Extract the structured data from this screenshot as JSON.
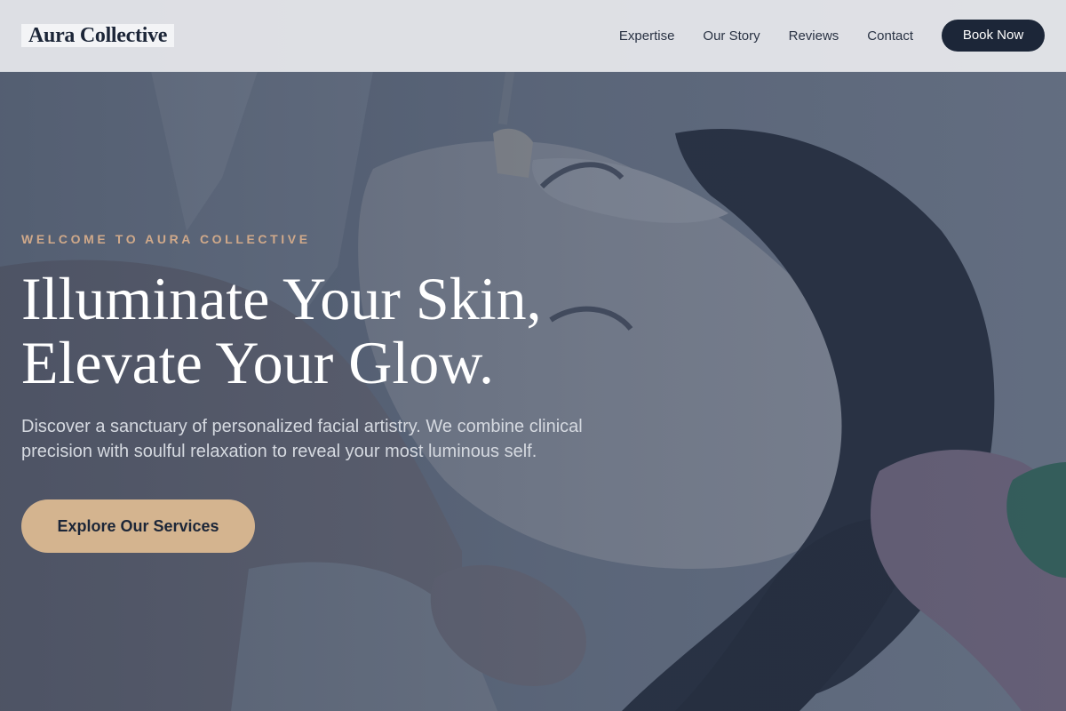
{
  "header": {
    "logo_text": "Aura Collective",
    "nav": [
      {
        "label": "Expertise"
      },
      {
        "label": "Our Story"
      },
      {
        "label": "Reviews"
      },
      {
        "label": "Contact"
      }
    ],
    "cta_label": "Book Now"
  },
  "hero": {
    "eyebrow": "WELCOME TO AURA COLLECTIVE",
    "headline_line1": "Illuminate Your Skin,",
    "headline_line2": "Elevate Your Glow.",
    "subtext": "Discover a sanctuary of personalized facial artistry. We combine clinical precision with soulful relaxation to reveal your most luminous self.",
    "cta_label": "Explore Our Services",
    "background_image": "man-receiving-facial-mask-treatment"
  },
  "colors": {
    "brand_dark": "#1c2638",
    "accent_gold": "#d4b48f",
    "eyebrow_gold": "#d0a98a",
    "header_bg": "#e8eaed"
  }
}
